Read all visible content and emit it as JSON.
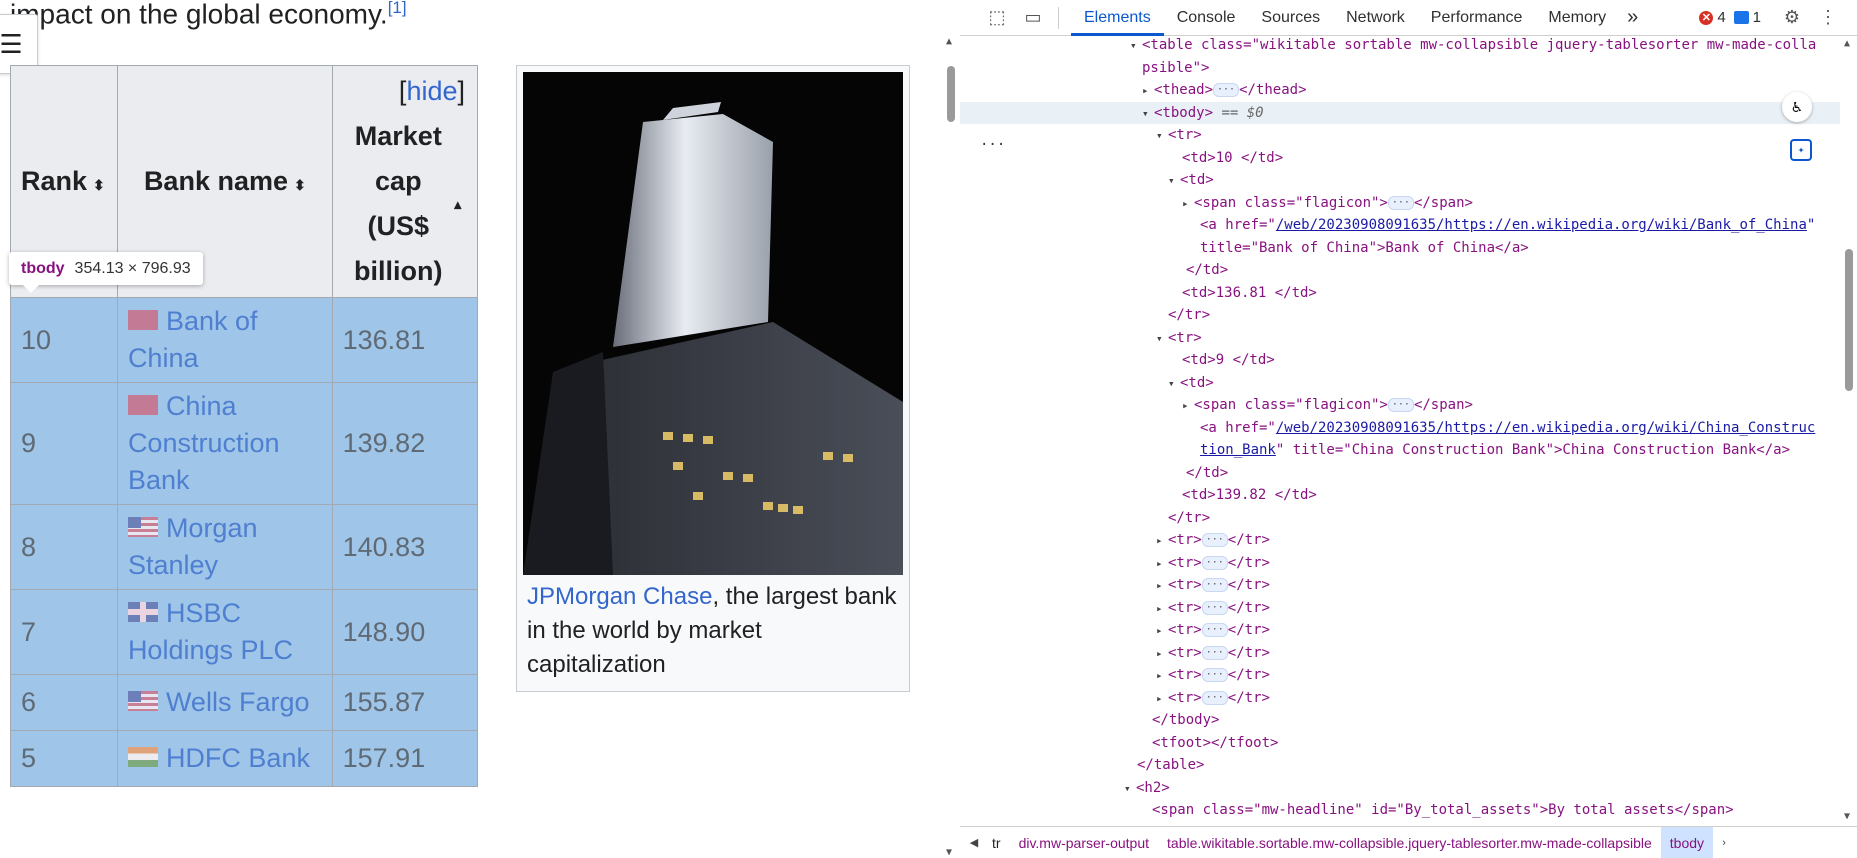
{
  "page": {
    "intro_text": "impact on the global economy.",
    "intro_ref": "[1]",
    "toc_icon": "list-menu-icon"
  },
  "table": {
    "headers": {
      "rank": "Rank",
      "bank_name": "Bank name",
      "hide_open": "[",
      "hide_link": "hide",
      "hide_close": "]",
      "market_cap": "Market cap (US$ billion)"
    },
    "rows": [
      {
        "rank": "10",
        "flag": "china-flag",
        "name": "Bank of China",
        "cap": "136.81"
      },
      {
        "rank": "9",
        "flag": "china-flag",
        "name": "China Construction Bank",
        "cap": "139.82"
      },
      {
        "rank": "8",
        "flag": "usa-flag",
        "name": "Morgan Stanley",
        "cap": "140.83"
      },
      {
        "rank": "7",
        "flag": "uk-flag",
        "name": "HSBC Holdings PLC",
        "cap": "148.90"
      },
      {
        "rank": "6",
        "flag": "usa-flag",
        "name": "Wells Fargo",
        "cap": "155.87"
      },
      {
        "rank": "5",
        "flag": "india-flag",
        "name": "HDFC Bank",
        "cap": "157.91"
      }
    ]
  },
  "tooltip": {
    "tag": "tbody",
    "size": "354.13 × 796.93"
  },
  "figure": {
    "caption_link": "JPMorgan Chase",
    "caption_rest": ", the largest bank in the world by market capitalization"
  },
  "devtools": {
    "tabs": [
      "Elements",
      "Console",
      "Sources",
      "Network",
      "Performance",
      "Memory"
    ],
    "active_tab": "Elements",
    "error_count": "4",
    "message_count": "1",
    "selected_marker": "== $0",
    "dom": {
      "table_open_1": "<table class=\"wikitable sortable mw-collapsible jquery-tablesorter mw-made-colla",
      "table_open_2": "psible\">",
      "thead": "<thead>",
      "thead_close": "</thead>",
      "tbody": "<tbody>",
      "tr": "<tr>",
      "tr_close": "</tr>",
      "td_10": "<td>10 </td>",
      "td_open": "<td>",
      "td_close": "</td>",
      "span_flag": "<span class=\"flagicon\">",
      "span_close": "</span>",
      "a_href_1": "<a href=\"",
      "boc_url": "/web/20230908091635/https://en.wikipedia.org/wiki/Bank_of_China",
      "boc_url_end": "\"",
      "boc_title": "title=\"Bank of China\">Bank of China</a>",
      "td_13681": "<td>136.81 </td>",
      "td_9": "<td>9 </td>",
      "ccb_url_1": "/web/20230908091635/https://en.wikipedia.org/wiki/China_Construc",
      "ccb_url_2": "tion_Bank",
      "ccb_title": "\" title=\"China Construction Bank\">China Construction Bank</a>",
      "td_13982": "<td>139.82 </td>",
      "tbody_close": "</tbody>",
      "tfoot": "<tfoot></tfoot>",
      "table_close": "</table>",
      "h2": "<h2>",
      "span_headline": "<span class=\"mw-headline\" id=\"By_total_assets\">By total assets</span>"
    },
    "breadcrumbs": [
      "tr",
      "div.mw-parser-output",
      "table.wikitable.sortable.mw-collapsible.jquery-tablesorter.mw-made-collapsible",
      "tbody"
    ]
  }
}
